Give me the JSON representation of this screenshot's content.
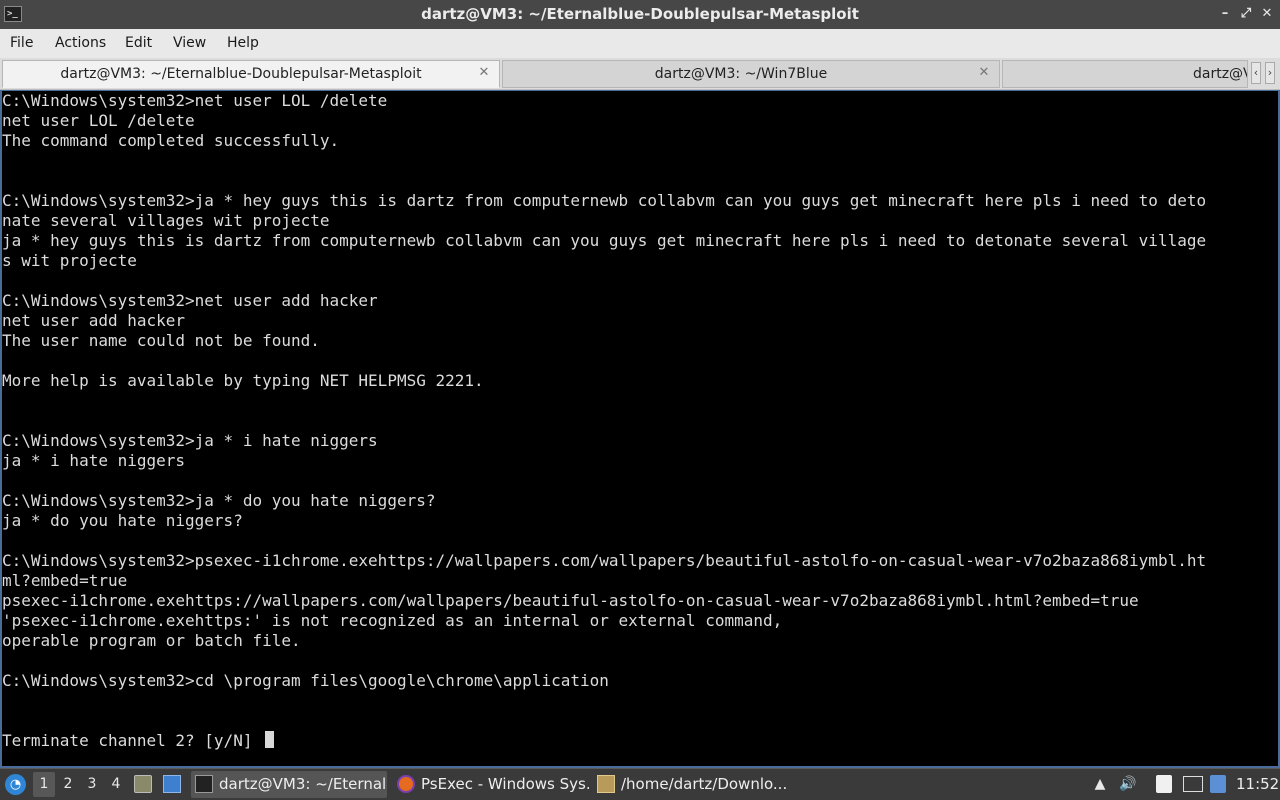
{
  "window": {
    "title": "dartz@VM3: ~/Eternalblue-Doublepulsar-Metasploit",
    "app_icon_glyph": ">_"
  },
  "menu": [
    "File",
    "Actions",
    "Edit",
    "View",
    "Help"
  ],
  "tabs": [
    {
      "label": "dartz@VM3: ~/Eternalblue-Doublepulsar-Metasploit",
      "active": true
    },
    {
      "label": "dartz@VM3: ~/Win7Blue",
      "active": false
    },
    {
      "label": "dartz@V",
      "active": false
    }
  ],
  "terminal_lines": [
    "C:\\Windows\\system32>net user LOL /delete",
    "net user LOL /delete",
    "The command completed successfully.",
    "",
    "",
    "C:\\Windows\\system32>ja * hey guys this is dartz from computernewb collabvm can you guys get minecraft here pls i need to deto",
    "nate several villages wit projecte",
    "ja * hey guys this is dartz from computernewb collabvm can you guys get minecraft here pls i need to detonate several village",
    "s wit projecte",
    "",
    "C:\\Windows\\system32>net user add hacker",
    "net user add hacker",
    "The user name could not be found.",
    "",
    "More help is available by typing NET HELPMSG 2221.",
    "",
    "",
    "C:\\Windows\\system32>ja * i hate niggers",
    "ja * i hate niggers",
    "",
    "C:\\Windows\\system32>ja * do you hate niggers?",
    "ja * do you hate niggers?",
    "",
    "C:\\Windows\\system32>psexec-i1chrome.exehttps://wallpapers.com/wallpapers/beautiful-astolfo-on-casual-wear-v7o2baza868iymbl.ht",
    "ml?embed=true",
    "psexec-i1chrome.exehttps://wallpapers.com/wallpapers/beautiful-astolfo-on-casual-wear-v7o2baza868iymbl.html?embed=true",
    "'psexec-i1chrome.exehttps:' is not recognized as an internal or external command,",
    "operable program or batch file.",
    "",
    "C:\\Windows\\system32>cd \\program files\\google\\chrome\\application",
    "",
    "",
    "Terminate channel 2? [y/N] "
  ],
  "taskbar": {
    "workspaces": [
      "1",
      "2",
      "3",
      "4"
    ],
    "active_workspace": "1",
    "tasks": [
      {
        "label": "dartz@VM3: ~/Eternal...",
        "icon": "terminal-icon",
        "active": true
      },
      {
        "label": "PsExec - Windows Sys...",
        "icon": "firefox-icon",
        "active": false
      },
      {
        "label": "/home/dartz/Downlo...",
        "icon": "archive-icon",
        "active": false
      }
    ],
    "clock": "11:52"
  },
  "colors": {
    "terminal_bg": "#000000",
    "terminal_fg": "#dcdcdc",
    "titlebar_bg": "#474747",
    "taskbar_bg": "#3a3a3a",
    "accent_blue": "#2f86d6"
  }
}
